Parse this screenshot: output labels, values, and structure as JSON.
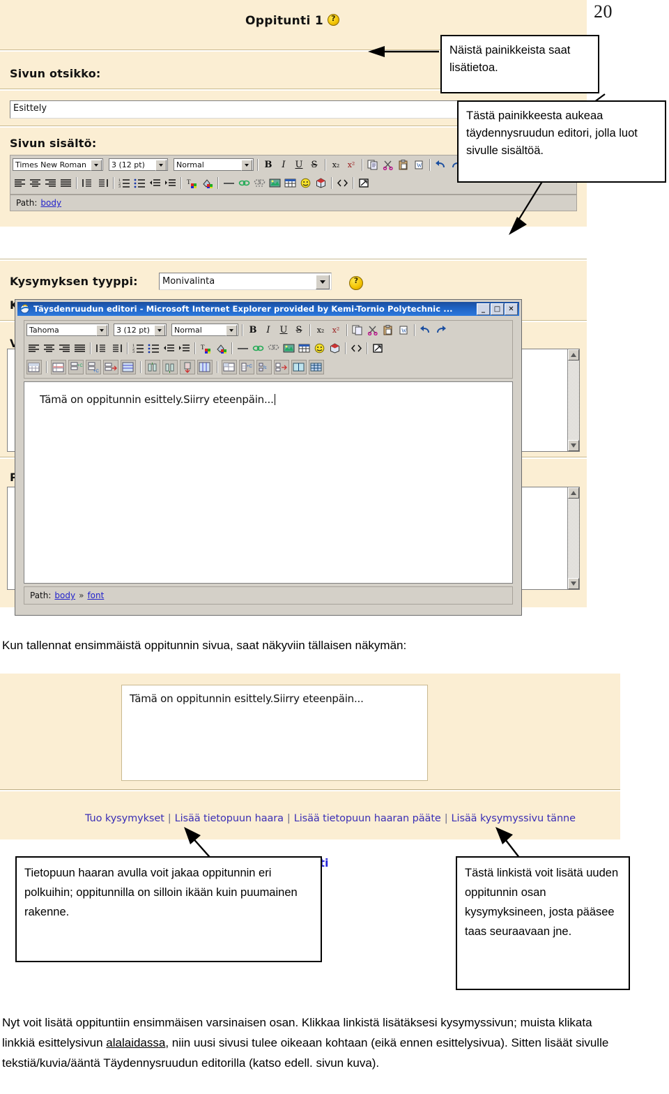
{
  "page": {
    "number": "20"
  },
  "screenshot1": {
    "header_title": "Oppitunti 1",
    "help_icon": "question-mark-help-icon",
    "label_page_title": "Sivun otsikko:",
    "page_title_value": "Esittely",
    "label_page_content": "Sivun sisältö:",
    "toolbar": {
      "font_family": "Times New Roman",
      "font_size": "3 (12 pt)",
      "paragraph_style": "Normal",
      "bold": "B",
      "italic": "I",
      "underline": "U",
      "strike": "S",
      "subscript": "x₂",
      "superscript": "x²",
      "copy": "copy-icon",
      "cut": "scissors-icon",
      "paste": "clipboard-icon",
      "paste_word": "paste-word-icon",
      "undo": "undo-icon",
      "redo": "redo-icon",
      "align_left": "align-left-icon",
      "align_center": "align-center-icon",
      "align_right": "align-right-icon",
      "align_justify": "align-justify-icon",
      "ltr": "direction-ltr-icon",
      "rtl": "direction-rtl-icon",
      "ordered_list": "ordered-list-icon",
      "unordered_list": "unordered-list-icon",
      "outdent": "outdent-icon",
      "indent": "indent-icon",
      "text_color": "text-color-icon",
      "background_color": "background-color-icon",
      "horizontal_rule": "horizontal-rule-icon",
      "insert_link": "link-icon",
      "unlink": "unlink-icon",
      "insert_image": "image-icon",
      "insert_table": "table-icon",
      "insert_emoticon": "smiley-icon",
      "insert_media": "media-icon",
      "html_source": "html-source-icon",
      "fullscreen": "fullscreen-editor-icon"
    },
    "path_label": "Path:",
    "path_items": [
      "body"
    ],
    "label_question_type": "Kysymyksen tyyppi:",
    "question_type_value": "Monivalinta",
    "hidden_labels": [
      "K",
      "V",
      "P"
    ]
  },
  "dialog": {
    "title": "Täysdenruudun editori - Microsoft Internet Explorer provided by Kemi-Tornio Polytechnic ...",
    "app_icon": "internet-explorer-icon",
    "minimize": "_",
    "maximize": "□",
    "close": "✕",
    "toolbar": {
      "font_family": "Tahoma",
      "font_size": "3 (12 pt)",
      "paragraph_style": "Normal",
      "bold": "B",
      "italic": "I",
      "underline": "U",
      "strike": "S",
      "subscript": "x₂",
      "superscript": "x²"
    },
    "content_text": "Tämä on oppitunnin esittely.Siirry eteenpäin...",
    "path_label": "Path:",
    "path_items": [
      "body",
      "font"
    ],
    "path_separator": "»"
  },
  "callouts": [
    {
      "id": "callout-buttons-info",
      "text": "Näistä painikkeista saat lisätietoa."
    },
    {
      "id": "callout-fullscreen-editor",
      "text": "Tästä painikkeesta aukeaa täydennysruudun editori, jolla luot sivulle sisältöä."
    },
    {
      "id": "callout-branch-table",
      "text": "Tietopuun haaran avulla voit jakaa oppitunnin eri polkuihin; oppitunnilla on silloin ikään kuin puumainen rakenne."
    },
    {
      "id": "callout-add-question-page",
      "text": "Tästä linkistä voit lisätä uuden oppitunnin osan kysymyksineen, josta pääsee taas seuraavaan jne."
    }
  ],
  "intro_sentence": "Kun tallennat ensimmäistä oppitunnin sivua, saat näkyviin tällaisen näkymän:",
  "screenshot2": {
    "content_text": "Tämä on oppitunnin esittely.Siirry eteenpäin...",
    "links": [
      "Tuo kysymykset",
      "Lisää tietopuun haara",
      "Lisää tietopuun haaran pääte",
      "Lisää kysymyssivu tänne"
    ],
    "link_separator": "|",
    "partially_hidden_link": "nti"
  },
  "bottom_paragraph": {
    "part1": "Nyt voit lisätä oppituntiin ensimmäisen varsinaisen osan. Klikkaa linkistä lisätäksesi kysymyssivun; muista klikata linkkiä esittelysivun ",
    "underlined": "alalaidassa",
    "part2": ", niin uusi sivusi tulee oikeaan kohtaan (eikä ennen esittelysivua). Sitten lisäät sivulle tekstiä/kuvia/ääntä Täydennysruudun editorilla (katso edell. sivun kuva)."
  },
  "colors": {
    "moodle_beige": "#fbeed3",
    "beige_border": "#c9b98f",
    "dialog_chrome": "#d4d0c8",
    "titlebar_blue": "#1f63c4",
    "link_blue": "#3b2fb5",
    "path_link_blue": "#2222cc"
  }
}
